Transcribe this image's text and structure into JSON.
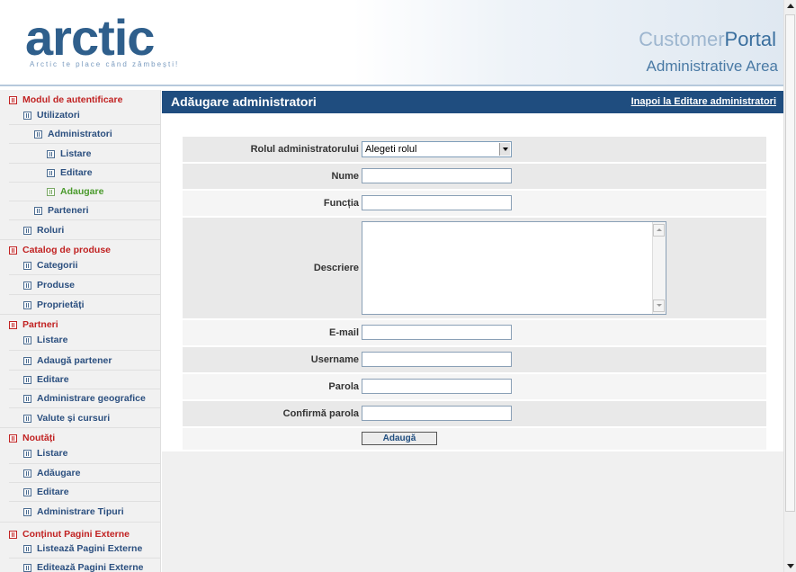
{
  "header": {
    "logo": "arctic",
    "tagline": "Arctic te place când zâmbești!",
    "portal_light": "Customer",
    "portal_bold": "Portal",
    "portal_subtitle": "Administrative Area"
  },
  "sidebar": {
    "items": [
      {
        "label": "Modul de autentificare"
      },
      {
        "label": "Utilizatori"
      },
      {
        "label": "Administratori"
      },
      {
        "label": "Listare"
      },
      {
        "label": "Editare"
      },
      {
        "label": "Adaugare"
      },
      {
        "label": "Parteneri"
      },
      {
        "label": "Roluri"
      },
      {
        "label": "Catalog de produse"
      },
      {
        "label": "Categorii"
      },
      {
        "label": "Produse"
      },
      {
        "label": "Proprietăți"
      },
      {
        "label": "Partneri"
      },
      {
        "label": "Listare"
      },
      {
        "label": "Adaugă partener"
      },
      {
        "label": "Editare"
      },
      {
        "label": "Administrare geografice"
      },
      {
        "label": "Valute și cursuri"
      },
      {
        "label": "Noutăți"
      },
      {
        "label": "Listare"
      },
      {
        "label": "Adăugare"
      },
      {
        "label": "Editare"
      },
      {
        "label": "Administrare Tipuri"
      },
      {
        "label": "Conținut Pagini Externe"
      },
      {
        "label": "Listează Pagini Externe"
      },
      {
        "label": "Editează Pagini Externe"
      }
    ]
  },
  "content": {
    "title": "Adăugare administratori",
    "back_link": "Inapoi la Editare administratori"
  },
  "form": {
    "role_label": "Rolul administratorului",
    "role_value": "Alegeti rolul",
    "name_label": "Nume",
    "function_label": "Funcția",
    "description_label": "Descriere",
    "email_label": "E-mail",
    "username_label": "Username",
    "password_label": "Parola",
    "confirm_label": "Confirmă parola",
    "submit_label": "Adaugă"
  }
}
